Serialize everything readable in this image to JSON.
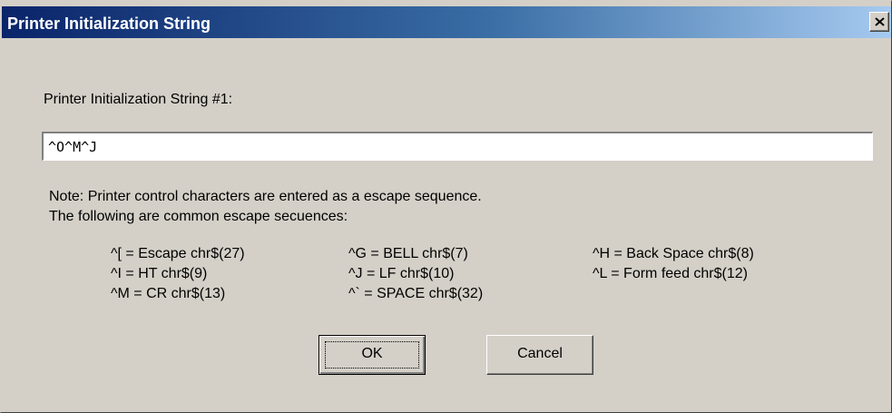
{
  "dialog": {
    "title": "Printer Initialization String",
    "close_glyph": "×"
  },
  "form": {
    "label": "Printer Initialization String #1:",
    "value": "^O^M^J"
  },
  "note": {
    "line1": "Note: Printer control characters are entered as a escape sequence.",
    "line2": "The following are common escape secuences:"
  },
  "sequences": [
    "^[ = Escape chr$(27)",
    "^G = BELL chr$(7)",
    "^H = Back Space chr$(8)",
    "^I = HT chr$(9)",
    "^J = LF chr$(10)",
    "^L = Form feed chr$(12)",
    "^M = CR chr$(13)",
    "^` = SPACE chr$(32)"
  ],
  "buttons": {
    "ok": "OK",
    "cancel": "Cancel"
  }
}
